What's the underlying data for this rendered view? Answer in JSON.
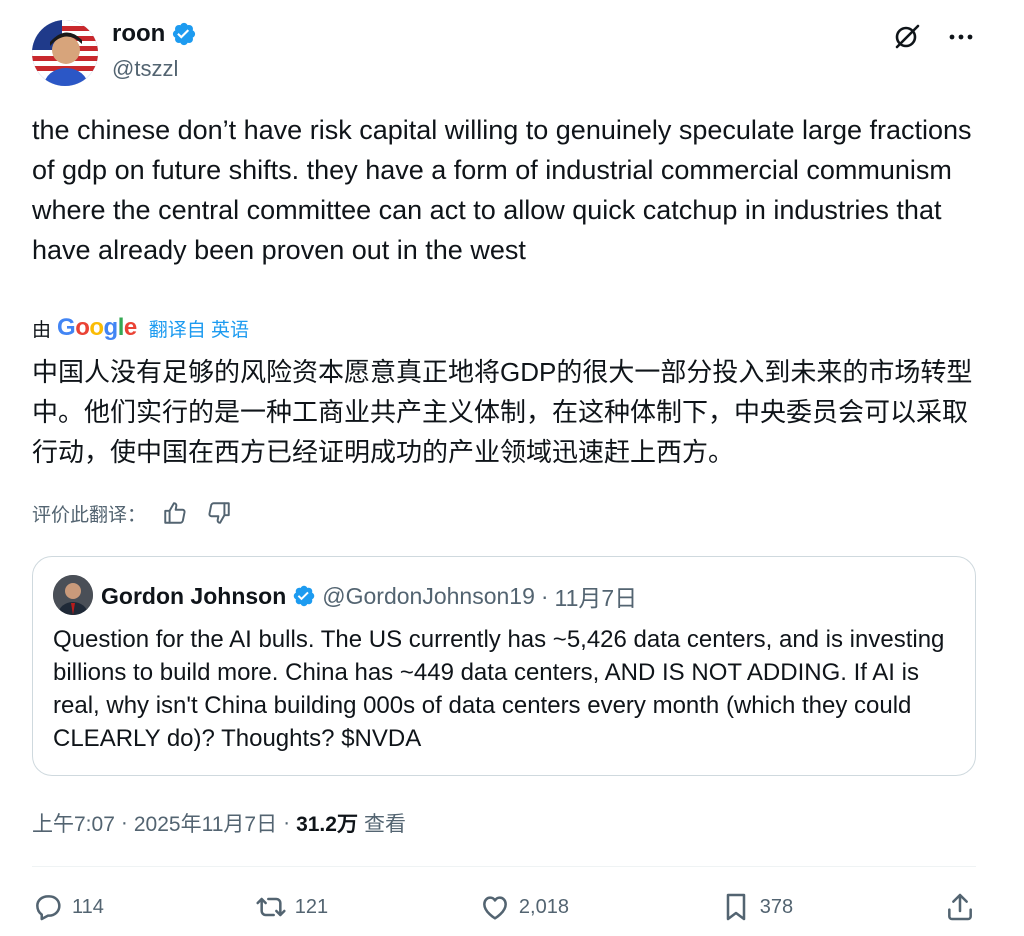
{
  "author": {
    "name": "roon",
    "handle": "@tszzl"
  },
  "tweet": {
    "text": "the chinese don’t have risk capital willing to genuinely speculate large fractions of gdp on future shifts. they have a form of industrial commercial communism where the central committee can act to allow quick catchup in industries that have already been proven out in the west"
  },
  "translation": {
    "by": "由",
    "provider_letters": [
      "G",
      "o",
      "o",
      "g",
      "l",
      "e"
    ],
    "link": "翻译自 英语",
    "text": "中国人没有足够的风险资本愿意真正地将GDP的很大一部分投入到未来的市场转型中。他们实行的是一种工商业共产主义体制，在这种体制下，中央委员会可以采取行动，使中国在西方已经证明成功的产业领域迅速赶上西方。",
    "rate_label": "评价此翻译："
  },
  "quote": {
    "name": "Gordon Johnson",
    "handle": "@GordonJohnson19",
    "separator": "·",
    "date": "11月7日",
    "text": "Question for the AI bulls. The US currently has ~5,426 data centers, and is investing billions to build more. China has ~449 data centers, AND IS NOT ADDING. If AI is real, why isn't China building 000s of data centers every month (which they could CLEARLY do)? Thoughts? $NVDA"
  },
  "meta": {
    "time": "上午7:07",
    "separator": "·",
    "date": "2025年11月7日",
    "views_count": "31.2万",
    "views_label": "查看"
  },
  "actions": {
    "replies": "114",
    "reposts": "121",
    "likes": "2,018",
    "bookmarks": "378"
  },
  "colors": {
    "verified": "#1d9bf0",
    "text": "#0f1419",
    "muted": "#536471",
    "link": "#1d9bf0",
    "border": "#cfd9de"
  },
  "icons": [
    "verified-badge-icon",
    "grok-icon",
    "more-icon",
    "thumbs-up-icon",
    "thumbs-down-icon",
    "reply-icon",
    "repost-icon",
    "like-icon",
    "bookmark-icon",
    "share-icon"
  ]
}
